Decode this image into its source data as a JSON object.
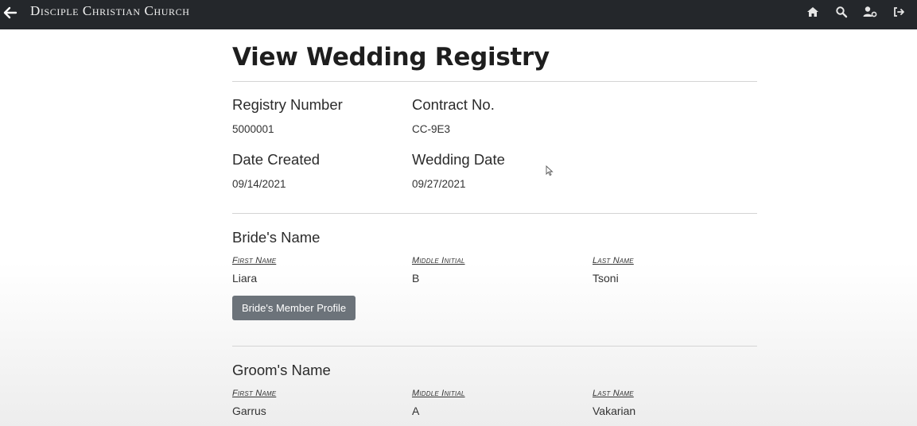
{
  "navbar": {
    "brand": "Disciple Christian Church",
    "icons": [
      "home-icon",
      "search-icon",
      "user-settings-icon",
      "logout-icon"
    ]
  },
  "page": {
    "title": "View Wedding Registry"
  },
  "registry": {
    "registry_number_label": "Registry Number",
    "registry_number": "5000001",
    "contract_label": "Contract No.",
    "contract": "CC-9E3",
    "date_created_label": "Date Created",
    "date_created": "09/14/2021",
    "wedding_date_label": "Wedding Date",
    "wedding_date": "09/27/2021"
  },
  "bride": {
    "section_title": "Bride's Name",
    "first_name_label": "First Name",
    "middle_initial_label": "Middle Initial",
    "last_name_label": "Last Name",
    "first_name": "Liara",
    "middle_initial": "B",
    "last_name": "Tsoni",
    "profile_button": "Bride's Member Profile"
  },
  "groom": {
    "section_title": "Groom's Name",
    "first_name_label": "First Name",
    "middle_initial_label": "Middle Initial",
    "last_name_label": "Last Name",
    "first_name": "Garrus",
    "middle_initial": "A",
    "last_name": "Vakarian"
  },
  "colors": {
    "navbar_bg": "#24272b",
    "button_bg": "#6c737a"
  }
}
